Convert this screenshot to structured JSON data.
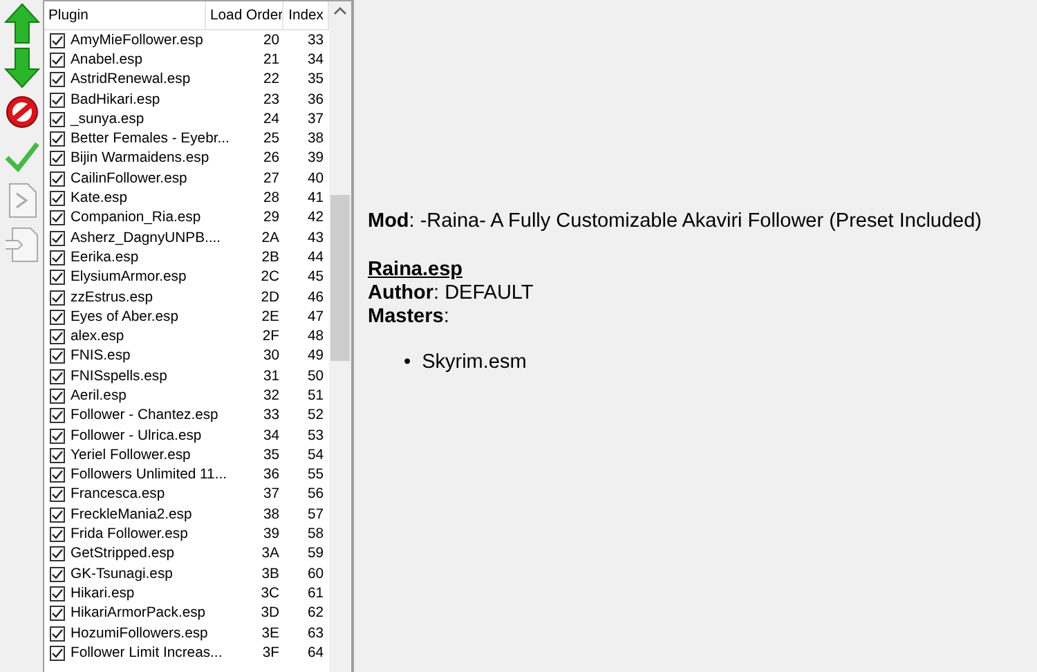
{
  "plugin_list": {
    "columns": [
      "Plugin",
      "Load Order",
      "Index"
    ],
    "rows": [
      {
        "checked": true,
        "plugin": "AmyMieFollower.esp",
        "load_order": "20",
        "index": "33"
      },
      {
        "checked": true,
        "plugin": "Anabel.esp",
        "load_order": "21",
        "index": "34"
      },
      {
        "checked": true,
        "plugin": "AstridRenewal.esp",
        "load_order": "22",
        "index": "35"
      },
      {
        "checked": true,
        "plugin": "BadHikari.esp",
        "load_order": "23",
        "index": "36"
      },
      {
        "checked": true,
        "plugin": "_sunya.esp",
        "load_order": "24",
        "index": "37"
      },
      {
        "checked": true,
        "plugin": "Better Females - Eyebr...",
        "load_order": "25",
        "index": "38"
      },
      {
        "checked": true,
        "plugin": "Bijin Warmaidens.esp",
        "load_order": "26",
        "index": "39"
      },
      {
        "checked": true,
        "plugin": "CailinFollower.esp",
        "load_order": "27",
        "index": "40"
      },
      {
        "checked": true,
        "plugin": "Kate.esp",
        "load_order": "28",
        "index": "41"
      },
      {
        "checked": true,
        "plugin": "Companion_Ria.esp",
        "load_order": "29",
        "index": "42"
      },
      {
        "checked": true,
        "plugin": "Asherz_DagnyUNPB....",
        "load_order": "2A",
        "index": "43"
      },
      {
        "checked": true,
        "plugin": "Eerika.esp",
        "load_order": "2B",
        "index": "44"
      },
      {
        "checked": true,
        "plugin": "ElysiumArmor.esp",
        "load_order": "2C",
        "index": "45"
      },
      {
        "checked": true,
        "plugin": "zzEstrus.esp",
        "load_order": "2D",
        "index": "46"
      },
      {
        "checked": true,
        "plugin": "Eyes of Aber.esp",
        "load_order": "2E",
        "index": "47"
      },
      {
        "checked": true,
        "plugin": "alex.esp",
        "load_order": "2F",
        "index": "48"
      },
      {
        "checked": true,
        "plugin": "FNIS.esp",
        "load_order": "30",
        "index": "49"
      },
      {
        "checked": true,
        "plugin": "FNISspells.esp",
        "load_order": "31",
        "index": "50"
      },
      {
        "checked": true,
        "plugin": "Aeril.esp",
        "load_order": "32",
        "index": "51"
      },
      {
        "checked": true,
        "plugin": "Follower - Chantez.esp",
        "load_order": "33",
        "index": "52"
      },
      {
        "checked": true,
        "plugin": "Follower - Ulrica.esp",
        "load_order": "34",
        "index": "53"
      },
      {
        "checked": true,
        "plugin": "Yeriel Follower.esp",
        "load_order": "35",
        "index": "54"
      },
      {
        "checked": true,
        "plugin": "Followers Unlimited 11...",
        "load_order": "36",
        "index": "55"
      },
      {
        "checked": true,
        "plugin": "Francesca.esp",
        "load_order": "37",
        "index": "56"
      },
      {
        "checked": true,
        "plugin": "FreckleMania2.esp",
        "load_order": "38",
        "index": "57"
      },
      {
        "checked": true,
        "plugin": "Frida Follower.esp",
        "load_order": "39",
        "index": "58"
      },
      {
        "checked": true,
        "plugin": "GetStripped.esp",
        "load_order": "3A",
        "index": "59"
      },
      {
        "checked": true,
        "plugin": "GK-Tsunagi.esp",
        "load_order": "3B",
        "index": "60"
      },
      {
        "checked": true,
        "plugin": "Hikari.esp",
        "load_order": "3C",
        "index": "61"
      },
      {
        "checked": true,
        "plugin": "HikariArmorPack.esp",
        "load_order": "3D",
        "index": "62"
      },
      {
        "checked": true,
        "plugin": "HozumiFollowers.esp",
        "load_order": "3E",
        "index": "63"
      },
      {
        "checked": true,
        "plugin": "Follower Limit Increas...",
        "load_order": "3F",
        "index": "64"
      }
    ]
  },
  "details": {
    "mod_line": "**Mod**: -Raina- A Fully Customizable Akaviri Follower (Preset Included)",
    "file_name": "Raina.esp",
    "author_line": "**Author**: DEFAULT",
    "masters_line": "**Masters**:",
    "masters": [
      {
        "bullet": "•",
        "name": "Skyrim.esm"
      }
    ]
  }
}
